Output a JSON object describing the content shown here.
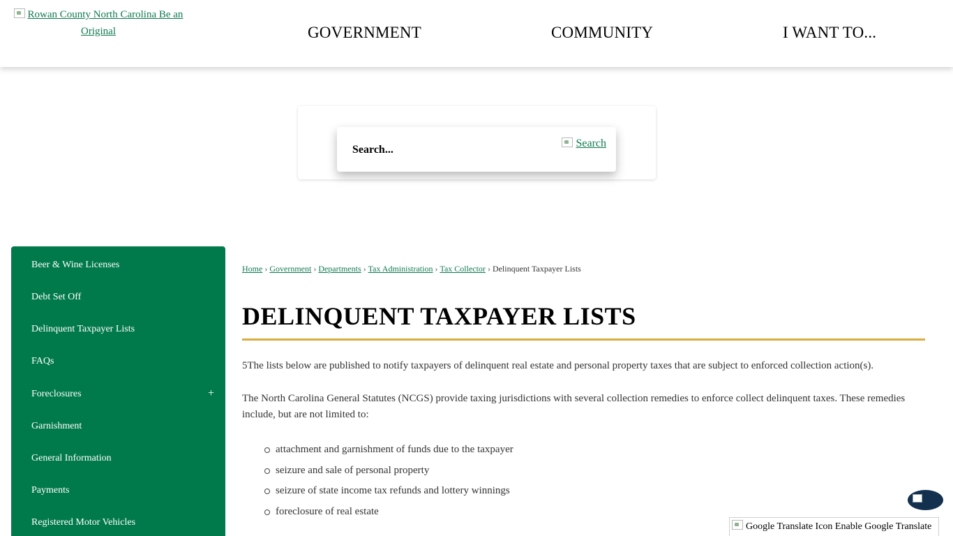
{
  "header": {
    "logo_alt": "Rowan County North Carolina Be an Original",
    "nav": [
      "GOVERNMENT",
      "COMMUNITY",
      "I WANT TO..."
    ]
  },
  "search": {
    "placeholder": "Search...",
    "button_alt": "Search"
  },
  "sidebar": {
    "items": [
      {
        "label": "Beer & Wine Licenses"
      },
      {
        "label": "Debt Set Off"
      },
      {
        "label": "Delinquent Taxpayer Lists"
      },
      {
        "label": "FAQs"
      },
      {
        "label": "Foreclosures",
        "expand": "+"
      },
      {
        "label": "Garnishment"
      },
      {
        "label": "General Information"
      },
      {
        "label": "Payments"
      },
      {
        "label": "Registered Motor Vehicles"
      }
    ]
  },
  "breadcrumb": {
    "links": [
      "Home",
      "Government",
      "Departments",
      "Tax Administration",
      "Tax Collector"
    ],
    "current": "Delinquent Taxpayer Lists",
    "separator": "›"
  },
  "page": {
    "title": "DELINQUENT TAXPAYER LISTS",
    "paragraphs": [
      "5The lists below are published to notify taxpayers of delinquent real estate and personal property taxes that are subject to enforced collection action(s).",
      "The North Carolina General Statutes (NCGS) provide taxing jurisdictions with several collection remedies to enforce collect delinquent taxes. These remedies include, but are not limited to:"
    ],
    "bullets": [
      "attachment and garnishment of funds due to the taxpayer",
      "seizure and sale of personal property",
      " seizure of state income tax refunds and lottery winnings",
      "foreclosure of real estate"
    ]
  },
  "translate": {
    "label": "Google Translate Icon Enable Google Translate"
  },
  "colors": {
    "brand_green": "#017a4b",
    "link_green": "#0f7a50",
    "title_rule_gold": "#d9ac3f",
    "chat_badge": "#14304f"
  }
}
